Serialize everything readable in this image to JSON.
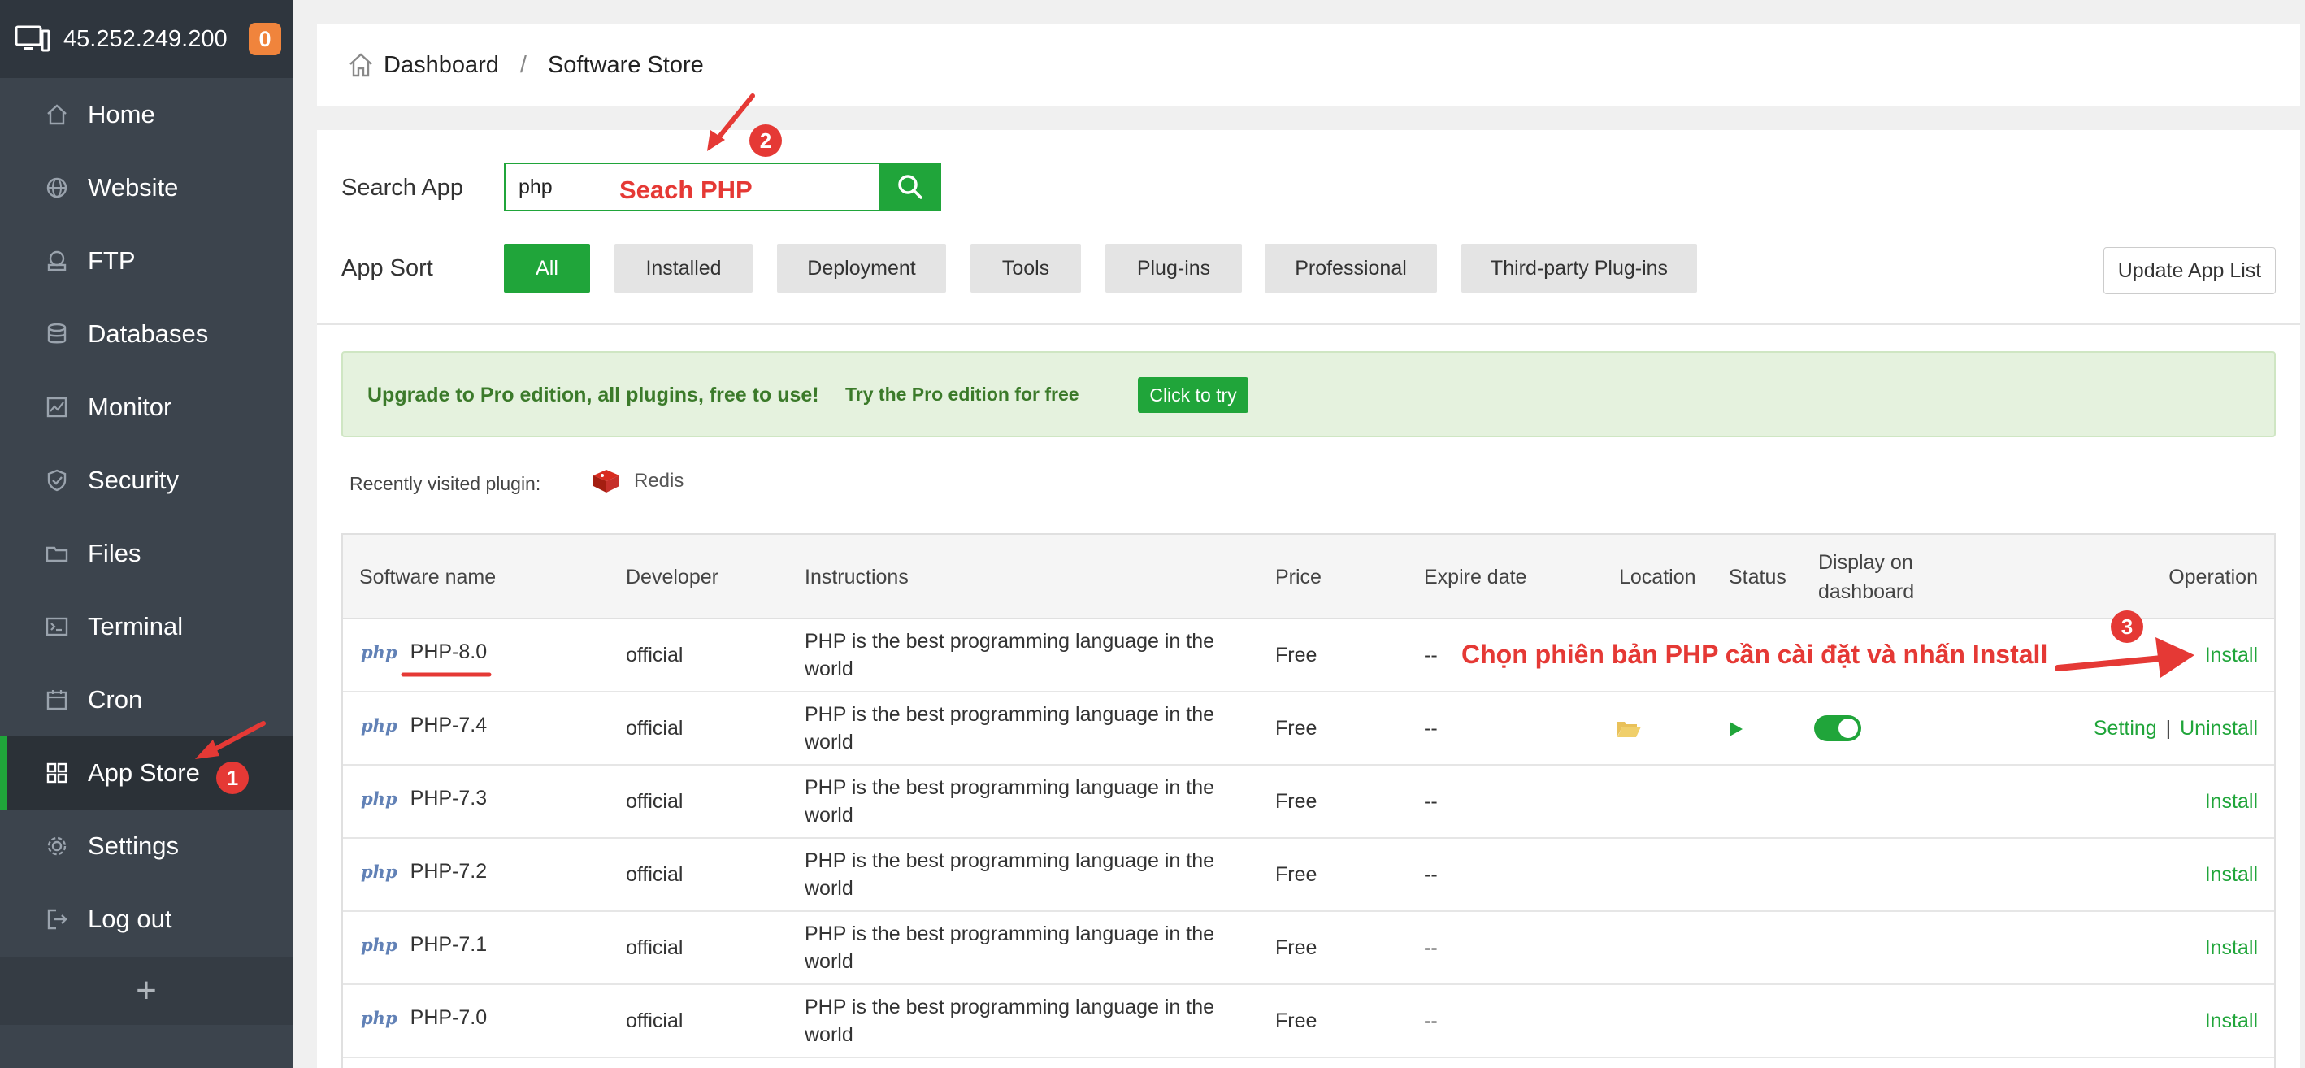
{
  "header": {
    "server_ip": "45.252.249.200",
    "notification_count": "0"
  },
  "sidebar": {
    "items": [
      {
        "label": "Home",
        "icon": "home-icon"
      },
      {
        "label": "Website",
        "icon": "globe-icon"
      },
      {
        "label": "FTP",
        "icon": "ftp-icon"
      },
      {
        "label": "Databases",
        "icon": "database-icon"
      },
      {
        "label": "Monitor",
        "icon": "monitor-icon"
      },
      {
        "label": "Security",
        "icon": "shield-icon"
      },
      {
        "label": "Files",
        "icon": "folder-icon"
      },
      {
        "label": "Terminal",
        "icon": "terminal-icon"
      },
      {
        "label": "Cron",
        "icon": "calendar-icon"
      },
      {
        "label": "App Store",
        "icon": "grid-icon",
        "active": true
      },
      {
        "label": "Settings",
        "icon": "gear-icon"
      },
      {
        "label": "Log out",
        "icon": "logout-icon"
      }
    ],
    "add_label": "+"
  },
  "breadcrumb": {
    "home": "Dashboard",
    "separator": "/",
    "current": "Software Store"
  },
  "search": {
    "label": "Search App",
    "value": "php"
  },
  "sort": {
    "label": "App Sort",
    "options": [
      "All",
      "Installed",
      "Deployment",
      "Tools",
      "Plug-ins",
      "Professional",
      "Third-party Plug-ins"
    ],
    "selected": "All"
  },
  "update_button": "Update App List",
  "promo": {
    "headline": "Upgrade to Pro edition, all plugins, free to use!",
    "sub": "Try the Pro edition for free",
    "button": "Click to try"
  },
  "recent": {
    "label": "Recently visited plugin:",
    "plugin": "Redis"
  },
  "table": {
    "headers": {
      "name": "Software name",
      "developer": "Developer",
      "instructions": "Instructions",
      "price": "Price",
      "expire": "Expire date",
      "location": "Location",
      "status": "Status",
      "display_line1": "Display on",
      "display_line2": "dashboard",
      "operation": "Operation"
    },
    "logo_text": "php",
    "rows": [
      {
        "name": "PHP-8.0",
        "developer": "official",
        "instructions": "PHP is the best programming language in the world",
        "price": "Free",
        "expire": "--",
        "operation": "Install"
      },
      {
        "name": "PHP-7.4",
        "developer": "official",
        "instructions": "PHP is the best programming language in the world",
        "price": "Free",
        "expire": "--",
        "installed": true,
        "op_setting": "Setting",
        "op_sep": "|",
        "op_uninstall": "Uninstall",
        "display_on_dashboard": true
      },
      {
        "name": "PHP-7.3",
        "developer": "official",
        "instructions": "PHP is the best programming language in the world",
        "price": "Free",
        "expire": "--",
        "operation": "Install"
      },
      {
        "name": "PHP-7.2",
        "developer": "official",
        "instructions": "PHP is the best programming language in the world",
        "price": "Free",
        "expire": "--",
        "operation": "Install"
      },
      {
        "name": "PHP-7.1",
        "developer": "official",
        "instructions": "PHP is the best programming language in the world",
        "price": "Free",
        "expire": "--",
        "operation": "Install"
      },
      {
        "name": "PHP-7.0",
        "developer": "official",
        "instructions": "PHP is the best programming language in the world",
        "price": "Free",
        "expire": "--",
        "operation": "Install"
      }
    ]
  },
  "annotations": {
    "search_hint": "Seach PHP",
    "install_hint": "Chọn phiên bản PHP cần cài đặt và nhấn Install",
    "step1": "1",
    "step2": "2",
    "step3": "3"
  },
  "colors": {
    "accent": "#20a53a",
    "sidebar": "#3c444d",
    "annotation": "#e53935",
    "badge": "#f0843c"
  }
}
